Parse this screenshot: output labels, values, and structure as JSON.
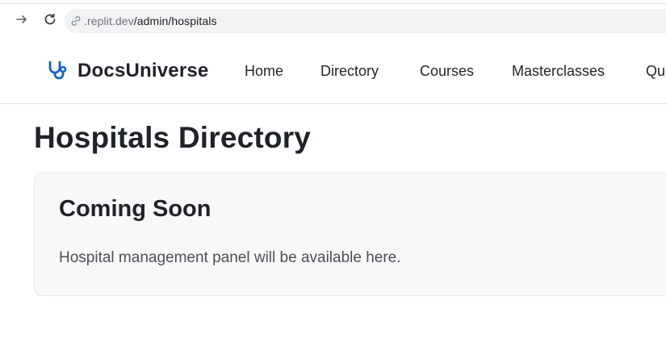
{
  "browser": {
    "url_host": ".replit.dev",
    "url_path": "/admin/hospitals",
    "icons": {
      "forward": "arrow-right-icon",
      "reload": "reload-icon",
      "site_info": "link-icon"
    }
  },
  "header": {
    "brand_name": "DocsUniverse",
    "brand_icon": "stethoscope-icon",
    "brand_color": "#1565c0",
    "nav": [
      {
        "label": "Home"
      },
      {
        "label": "Directory"
      },
      {
        "label": "Courses"
      },
      {
        "label": "Masterclasses"
      },
      {
        "label": "Qu"
      }
    ]
  },
  "main": {
    "title": "Hospitals Directory",
    "card": {
      "title": "Coming Soon",
      "body": "Hospital management panel will be available here."
    }
  }
}
